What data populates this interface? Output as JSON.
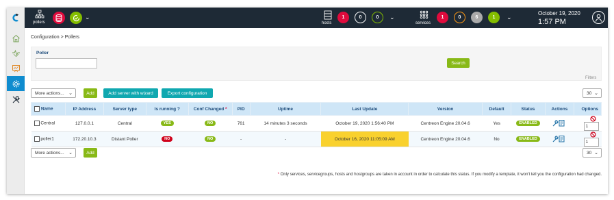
{
  "topbar": {
    "pollers_label": "pollers",
    "hosts_label": "hosts",
    "services_label": "services",
    "hosts_counts": [
      "1",
      "0",
      "0"
    ],
    "services_counts": [
      "1",
      "0",
      "6",
      "1"
    ],
    "date": "October 19, 2020",
    "time": "1:57 PM"
  },
  "breadcrumb": {
    "part1": "Configuration",
    "sep": ">",
    "part2": "Pollers"
  },
  "filter": {
    "poller_label": "Poller",
    "poller_value": "",
    "search_button": "Search",
    "filters_label": "Filters"
  },
  "toolbar": {
    "more_actions": "More actions...",
    "add_button": "Add",
    "add_wizard_button": "Add server with wizard",
    "export_button": "Export configuration",
    "page_size": "30"
  },
  "table": {
    "headers": [
      "Name",
      "IP Address",
      "Server type",
      "Is running ?",
      "Conf Changed",
      "PID",
      "Uptime",
      "Last Update",
      "Version",
      "Default",
      "Status",
      "Actions",
      "Options"
    ],
    "conf_changed_star": "*",
    "rows": [
      {
        "name": "Central",
        "ip": "127.0.0.1",
        "server_type": "Central",
        "is_running": "YES",
        "conf_changed": "NO",
        "pid": "761",
        "uptime": "14 minutes 3 seconds",
        "last_update": "October 19, 2020 1:56:40 PM",
        "version": "Centreon Engine 20.04.6",
        "default": "Yes",
        "status": "ENABLED",
        "option_value": "1"
      },
      {
        "name": "poller1",
        "ip": "172.20.10.3",
        "server_type": "Distant Poller",
        "is_running": "NO",
        "conf_changed": "NO",
        "pid": "-",
        "uptime": "-",
        "last_update": "October 16, 2020 11:05:09 AM",
        "version": "Centreon Engine 20.04.6",
        "default": "No",
        "status": "ENABLED",
        "option_value": "1"
      }
    ]
  },
  "bottom_toolbar": {
    "more_actions": "More actions...",
    "add_button": "Add",
    "page_size": "30"
  },
  "footnote": {
    "star": "*",
    "text": " Only services, servicegroups, hosts and hostgroups are taken in account in order to calculate this status. If you modify a template, it won't tell you the configuration had changed."
  },
  "colors": {
    "topbar_bg": "#1e2a36",
    "accent_blue": "#0f8ccf",
    "green": "#88b917",
    "red": "#e00b3d",
    "teal": "#10a8b0",
    "highlight_yellow": "#f9d12e",
    "table_header": "#cfe6f7"
  },
  "icons": {
    "sidebar": [
      "centreon-logo-icon",
      "home-icon",
      "monitoring-icon",
      "reporting-icon",
      "configuration-gear-icon",
      "administration-tools-icon"
    ],
    "topbar": [
      "pollers-network-icon",
      "database-icon",
      "status-ok-icon",
      "hosts-server-icon",
      "services-grid-icon",
      "user-profile-icon"
    ]
  }
}
